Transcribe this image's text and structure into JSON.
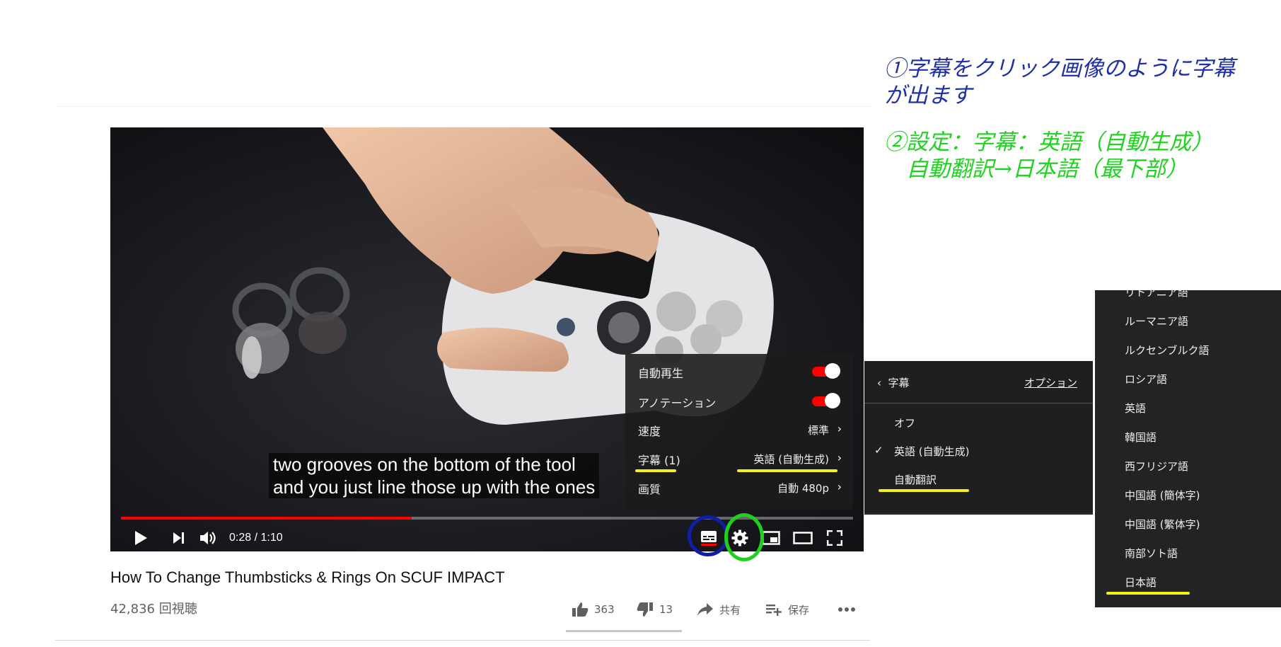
{
  "annotations": {
    "step1_line1": "①字幕をクリック画像のように字幕",
    "step1_line2": "が出ます",
    "step2_line1": "②設定：字幕：英語（自動生成）",
    "step2_line2": "　自動翻訳→日本語（最下部）",
    "step1_color": "#1f2fa8",
    "step2_color": "#21d321",
    "highlight_color": "#f5ef1c"
  },
  "player": {
    "caption_line1": "two grooves on the bottom of the tool",
    "caption_line2": "and you just line those up with the ones",
    "time_display": "0:28 / 1:10",
    "progress_fraction": 0.397,
    "accent_color": "#ff0000"
  },
  "settings_menu": {
    "autoplay_label": "自動再生",
    "autoplay_on": true,
    "annotations_label": "アノテーション",
    "annotations_on": true,
    "speed_label": "速度",
    "speed_value": "標準",
    "subtitles_label": "字幕 (1)",
    "subtitles_value": "英語 (自動生成)",
    "quality_label": "画質",
    "quality_value": "自動 480p"
  },
  "caption_submenu": {
    "title": "字幕",
    "options_link": "オプション",
    "items": [
      "オフ",
      "英語 (自動生成)",
      "自動翻訳"
    ],
    "selected_index": 1
  },
  "language_list": {
    "items": [
      "リトアニア語",
      "ルーマニア語",
      "ルクセンブルク語",
      "ロシア語",
      "英語",
      "韓国語",
      "西フリジア語",
      "中国語 (簡体字)",
      "中国語 (繁体字)",
      "南部ソト語",
      "日本語"
    ]
  },
  "video": {
    "title": "How To Change Thumbsticks & Rings On SCUF IMPACT",
    "views": "42,836 回視聴",
    "likes": "363",
    "dislikes": "13",
    "share_label": "共有",
    "save_label": "保存"
  }
}
